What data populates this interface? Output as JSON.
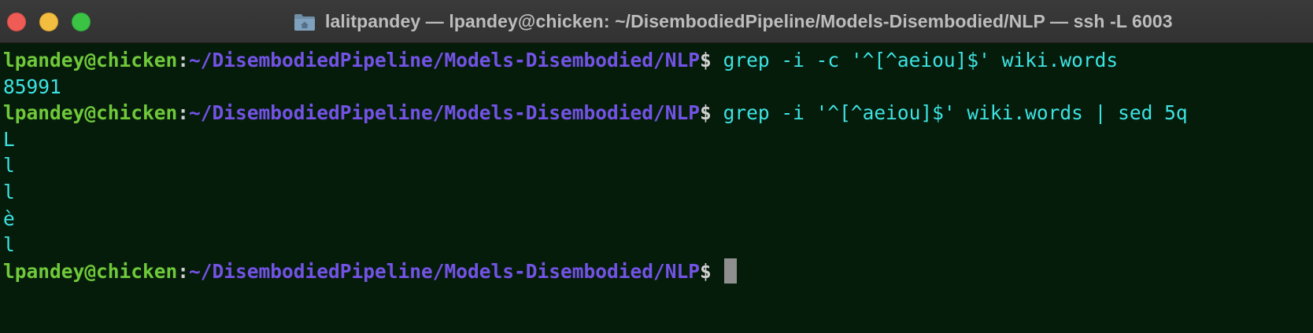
{
  "window": {
    "title": "lalitpandey — lpandey@chicken: ~/DisembodiedPipeline/Models-Disembodied/NLP — ssh -L 6003",
    "folder_icon": "home-folder-icon",
    "colors": {
      "background": "#061c0b",
      "user": "#6fc93a",
      "path": "#7353e6",
      "command": "#3de3e3"
    }
  },
  "traffic_lights": {
    "close": "close-icon",
    "minimize": "minimize-icon",
    "zoom": "zoom-icon"
  },
  "terminal": {
    "prompt": {
      "user_host": "lpandey@chicken",
      "colon": ":",
      "path": "~/DisembodiedPipeline/Models-Disembodied/NLP",
      "dollar": "$"
    },
    "commands": [
      " grep -i -c '^[^aeiou]$' wiki.words",
      " grep -i '^[^aeiou]$' wiki.words | sed 5q"
    ],
    "outputs": [
      "85991",
      "L",
      "l",
      "l",
      "è",
      "l"
    ]
  }
}
